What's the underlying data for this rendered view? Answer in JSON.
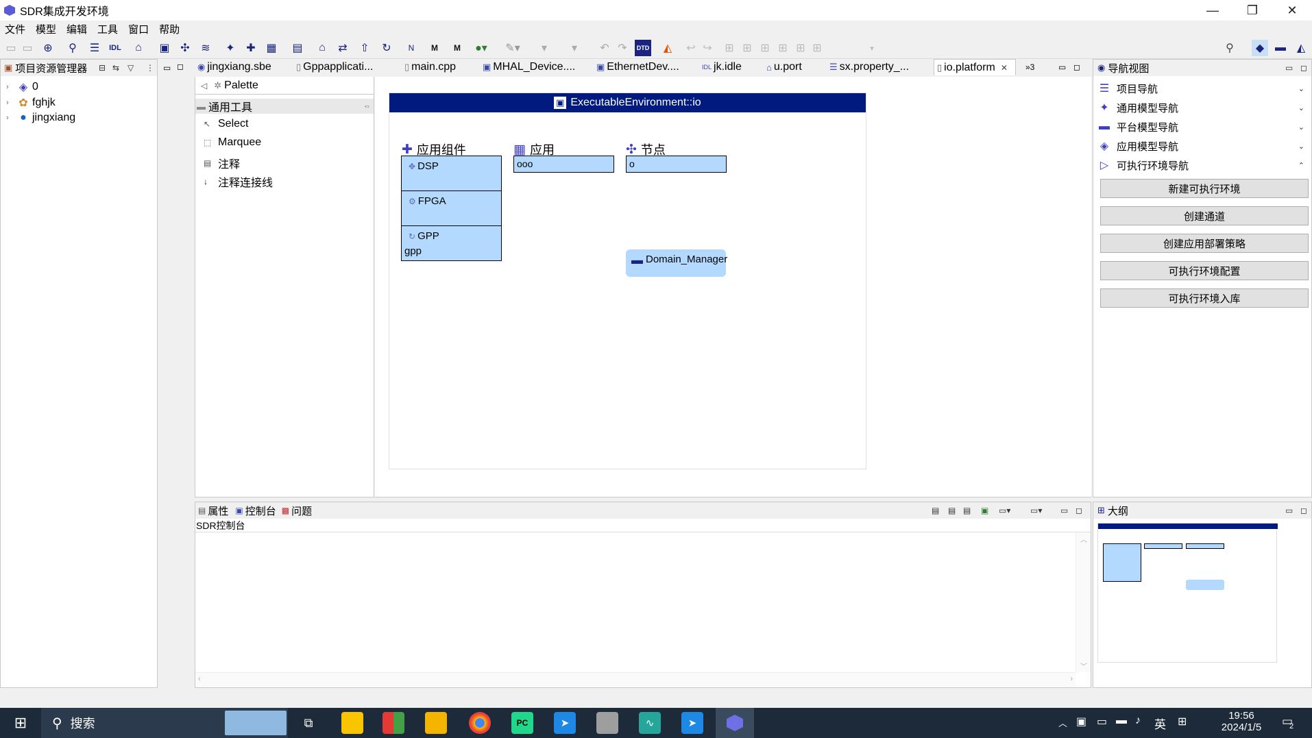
{
  "window": {
    "title": "SDR集成开发环境",
    "min": "—",
    "max": "❐",
    "close": "✕"
  },
  "menu": [
    "文件",
    "模型",
    "编辑",
    "工具",
    "窗口",
    "帮助"
  ],
  "project_explorer": {
    "title": "项目资源管理器",
    "items": [
      {
        "label": "0"
      },
      {
        "label": "fghjk"
      },
      {
        "label": "jingxiang"
      }
    ]
  },
  "editor_tabs": [
    {
      "label": "jingxiang.sbe"
    },
    {
      "label": "Gppapplicati..."
    },
    {
      "label": "main.cpp"
    },
    {
      "label": "MHAL_Device...."
    },
    {
      "label": "EthernetDev...."
    },
    {
      "label": "jk.idle"
    },
    {
      "label": "u.port"
    },
    {
      "label": "sx.property_..."
    },
    {
      "label": "io.platform"
    }
  ],
  "tab_overflow": "»3",
  "palette": {
    "title": "Palette",
    "group": "通用工具",
    "items": [
      "Select",
      "Marquee",
      "注释",
      "注释连接线"
    ]
  },
  "diagram": {
    "title": "ExecutableEnvironment::io",
    "components": {
      "label": "应用组件",
      "cells": [
        {
          "label": "DSP",
          "sub": ""
        },
        {
          "label": "FPGA",
          "sub": ""
        },
        {
          "label": "GPP",
          "sub": "gpp"
        }
      ]
    },
    "applications": {
      "label": "应用",
      "value": "ooo"
    },
    "nodes": {
      "label": "节点",
      "value": "o"
    },
    "domain_manager": "Domain_Manager"
  },
  "bottom": {
    "tabs": [
      "属性",
      "控制台",
      "问题"
    ],
    "console_title": "SDR控制台"
  },
  "nav_view": {
    "title": "导航视图",
    "items": [
      "项目导航",
      "通用模型导航",
      "平台模型导航",
      "应用模型导航",
      "可执行环境导航"
    ],
    "buttons": [
      "新建可执行环境",
      "创建通道",
      "创建应用部署策略",
      "可执行环境配置",
      "可执行环境入库"
    ]
  },
  "outline": {
    "title": "大纲"
  },
  "taskbar": {
    "search": "搜索",
    "ime": "英",
    "time": "19:56",
    "date": "2024/1/5",
    "notif": "2"
  },
  "colors": {
    "diagram_header": "#001a80",
    "box_fill": "#b3d9ff",
    "taskbar": "#1c2a3a",
    "accent": "#3f3fbf"
  }
}
